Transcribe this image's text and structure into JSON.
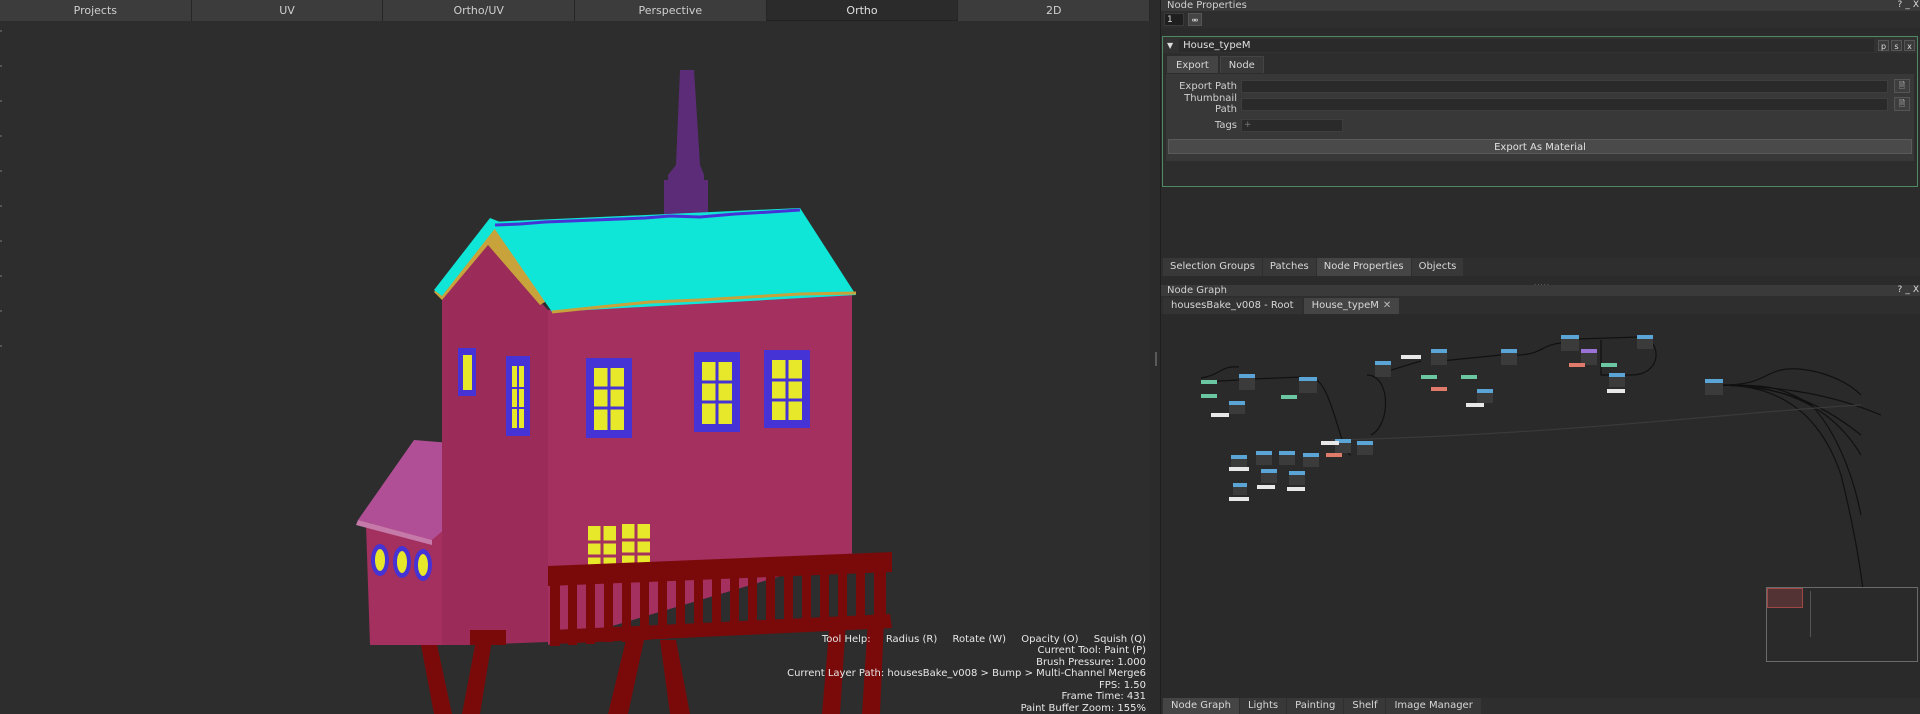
{
  "viewport": {
    "tabs": [
      {
        "label": "Projects",
        "active": false
      },
      {
        "label": "UV",
        "active": false
      },
      {
        "label": "Ortho/UV",
        "active": false
      },
      {
        "label": "Perspective",
        "active": false
      },
      {
        "label": "Ortho",
        "active": true
      },
      {
        "label": "2D",
        "active": false
      }
    ],
    "tool_help": {
      "label": "Tool Help:",
      "keys": [
        "Radius (R)",
        "Rotate (W)",
        "Opacity (O)",
        "Squish (Q)"
      ],
      "current_tool": "Current Tool: Paint (P)",
      "brush_pressure": "Brush Pressure: 1.000",
      "layer_path": "Current Layer Path: housesBake_v008 > Bump > Multi-Channel Merge6",
      "fps": "FPS: 1.50",
      "frame_time": "Frame Time: 431",
      "buffer_zoom": "Paint Buffer Zoom: 155%"
    },
    "colors": {
      "roof": "#0fe6d8",
      "walls": "#a3305f",
      "windows": "#e8e82a",
      "frames": "#4633d6",
      "chimney": "#5d2c78",
      "deck": "#7a0a0a",
      "annex_roof": "#b14f96"
    }
  },
  "node_properties": {
    "title": "Node Properties",
    "panel_buttons": [
      "?",
      "_",
      "X"
    ],
    "toolbar_value": "1",
    "pin_icon": "pin-icon",
    "node": {
      "name": "House_typeM",
      "head_buttons": [
        "p",
        "s",
        "x"
      ],
      "tabs": [
        {
          "label": "Export",
          "active": true
        },
        {
          "label": "Node",
          "active": false
        }
      ],
      "fields": {
        "export_path_label": "Export Path",
        "export_path_value": "",
        "thumbnail_path_label": "Thumbnail Path",
        "thumbnail_path_value": "",
        "tags_label": "Tags",
        "tags_placeholder": "+"
      },
      "export_button": "Export As Material"
    }
  },
  "panel_tabs": [
    {
      "label": "Selection Groups",
      "active": false
    },
    {
      "label": "Patches",
      "active": false
    },
    {
      "label": "Node Properties",
      "active": true
    },
    {
      "label": "Objects",
      "active": false
    }
  ],
  "node_graph": {
    "title": "Node Graph",
    "panel_buttons": [
      "?",
      "_",
      "X"
    ],
    "tabs": [
      {
        "label": "housesBake_v008 - Root",
        "active": false
      },
      {
        "label": "House_typeM",
        "active": true,
        "closable": "✕"
      }
    ]
  },
  "bottom_tabs": [
    {
      "label": "Node Graph",
      "active": true
    },
    {
      "label": "Lights",
      "active": false
    },
    {
      "label": "Painting",
      "active": false
    },
    {
      "label": "Shelf",
      "active": false
    },
    {
      "label": "Image Manager",
      "active": false
    }
  ]
}
